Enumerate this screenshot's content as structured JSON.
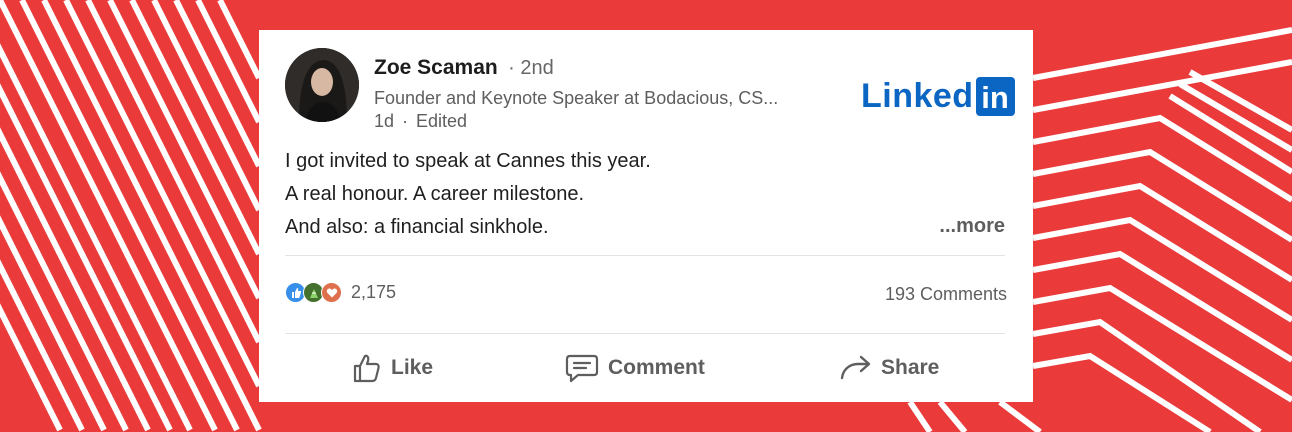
{
  "post": {
    "author": "Zoe Scaman",
    "degree": "· 2nd",
    "headline": "Founder and Keynote Speaker at Bodacious, CS...",
    "time": "1d",
    "edited": "Edited",
    "body": [
      "I got invited to speak at Cannes this year.",
      "A real honour. A career milestone.",
      "And also: a financial sinkhole."
    ],
    "more_label": "...more",
    "reactions": {
      "icons": [
        "like-icon",
        "celebrate-icon",
        "love-icon"
      ],
      "count": "2,175"
    },
    "comments": "193 Comments",
    "actions": {
      "like": "Like",
      "comment": "Comment",
      "share": "Share"
    }
  },
  "logo": {
    "word": "Linked",
    "box": "in"
  },
  "colors": {
    "background": "#ea3a3a",
    "stripes": "#ffffff",
    "brand": "#0a66c2"
  }
}
